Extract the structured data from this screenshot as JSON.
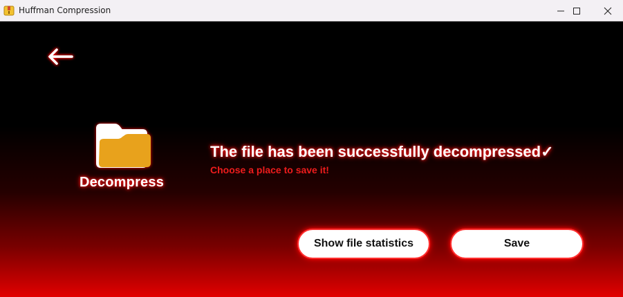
{
  "window": {
    "title": "Huffman Compression",
    "controls": [
      "minimize",
      "maximize",
      "close"
    ]
  },
  "nav": {
    "back_icon": "arrow-left-icon"
  },
  "action": {
    "label": "Decompress",
    "icon": "folder-icon"
  },
  "status": {
    "title": "The file has been successfully decompressed✓",
    "subtitle": "Choose a place to save it!"
  },
  "buttons": {
    "stats_label": "Show file statistics",
    "save_label": "Save"
  },
  "colors": {
    "background_top": "#000000",
    "background_bottom": "#e20000",
    "glow": "#ff0000",
    "subtitle": "#ee1c1c",
    "folder": "#e8a21c"
  }
}
